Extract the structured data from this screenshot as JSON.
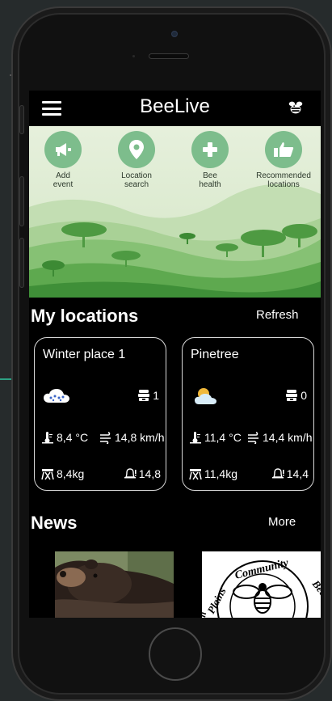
{
  "app": {
    "title": "BeeLive"
  },
  "icons": {
    "menu": "hamburger-menu-icon",
    "bee": "bee-icon",
    "add_event": "megaphone-icon",
    "location_search": "map-pin-icon",
    "bee_health": "plus-icon",
    "recommended": "thumbs-up-icon",
    "weather_snow": "snow-cloud-icon",
    "weather_partly": "partly-cloudy-icon",
    "hive": "hive-icon",
    "temperature": "thermometer-icon",
    "wind": "wind-icon",
    "scale": "scale-icon",
    "alarm": "bell-alert-icon"
  },
  "quick_actions": [
    {
      "label_line1": "Add",
      "label_line2": "event"
    },
    {
      "label_line1": "Location",
      "label_line2": "search"
    },
    {
      "label_line1": "Bee",
      "label_line2": "health"
    },
    {
      "label_line1": "Recommended",
      "label_line2": "locations"
    }
  ],
  "locations_section": {
    "title": "My locations",
    "action": "Refresh"
  },
  "locations": [
    {
      "name": "Winter place 1",
      "hives": "1",
      "temperature": "8,4 °C",
      "wind": "14,8 km/h",
      "weight": "8,4kg",
      "alert": "14,8"
    },
    {
      "name": "Pinetree",
      "hives": "0",
      "temperature": "11,4 °C",
      "wind": "14,4 km/h",
      "weight": "11,4kg",
      "alert": "14,4"
    }
  ],
  "news_section": {
    "title": "News",
    "action": "More"
  },
  "news": [
    {
      "image": "bear-photo"
    },
    {
      "image": "community-beekeepers-logo",
      "logo_text": "Plains Community Beekeepers"
    }
  ],
  "colors": {
    "background": "#262b2c",
    "screen": "#000000",
    "accent_green": "#7dbd8c",
    "sky": "#dfeccf"
  }
}
